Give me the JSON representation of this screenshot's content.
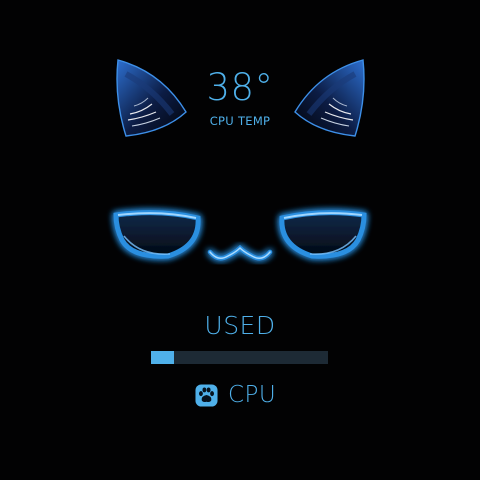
{
  "temperature": {
    "value": "38°",
    "label": "CPU TEMP"
  },
  "usage": {
    "label": "USED",
    "percent": 13
  },
  "device": {
    "label": "CPU",
    "icon": "paw-icon"
  },
  "face": {
    "expression": "grumpy cat"
  },
  "colors": {
    "background": "#020203",
    "accent": "#4fb0ea",
    "glow": "#2b8fe0",
    "bar_track": "#1d2a35",
    "ear_dark": "#0b1736"
  }
}
